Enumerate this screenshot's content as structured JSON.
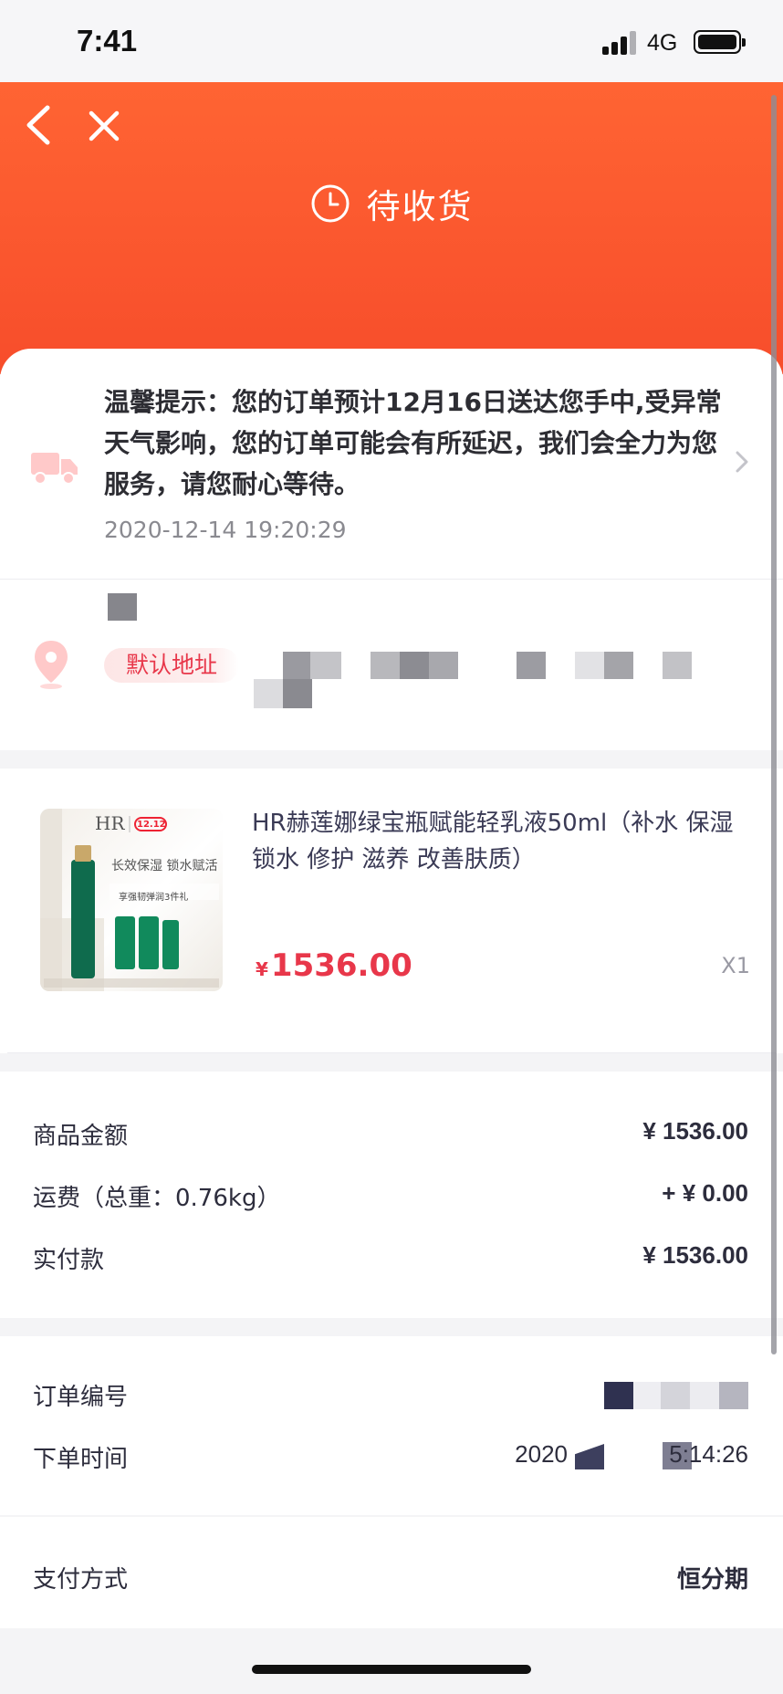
{
  "status_bar": {
    "time": "7:41",
    "network": "4G"
  },
  "header": {
    "title": "待收货"
  },
  "notice": {
    "text": "温馨提示：您的订单预计12月16日送达您手中,受异常天气影响，您的订单可能会有所延迟，我们会全力为您服务，请您耐心等待。",
    "time": "2020-12-14 19:20:29"
  },
  "address": {
    "badge": "默认地址"
  },
  "product": {
    "name": "HR赫莲娜绿宝瓶赋能轻乳液50ml（补水 保湿 锁水 修护 滋养 改善肤质）",
    "currency": "¥",
    "price": "1536.00",
    "quantity": "X1",
    "image": {
      "brand": "HR",
      "badge": "12.12",
      "headline": "长效保湿 锁水赋活",
      "gift": "享强韧弹润3件礼"
    }
  },
  "summary": {
    "rows": [
      {
        "label": "商品金额",
        "value": "¥ 1536.00"
      },
      {
        "label": "运费（总重：0.76kg）",
        "value": "+ ¥ 0.00"
      },
      {
        "label": "实付款",
        "value": "¥ 1536.00"
      }
    ]
  },
  "order": {
    "number_label": "订单编号",
    "time_label": "下单时间",
    "time_value_start": "2020",
    "time_value_end": "5:14:26"
  },
  "payment": {
    "label": "支付方式",
    "value": "恒分期"
  },
  "colors": {
    "accent": "#f74d2b",
    "price": "#e8374a"
  }
}
